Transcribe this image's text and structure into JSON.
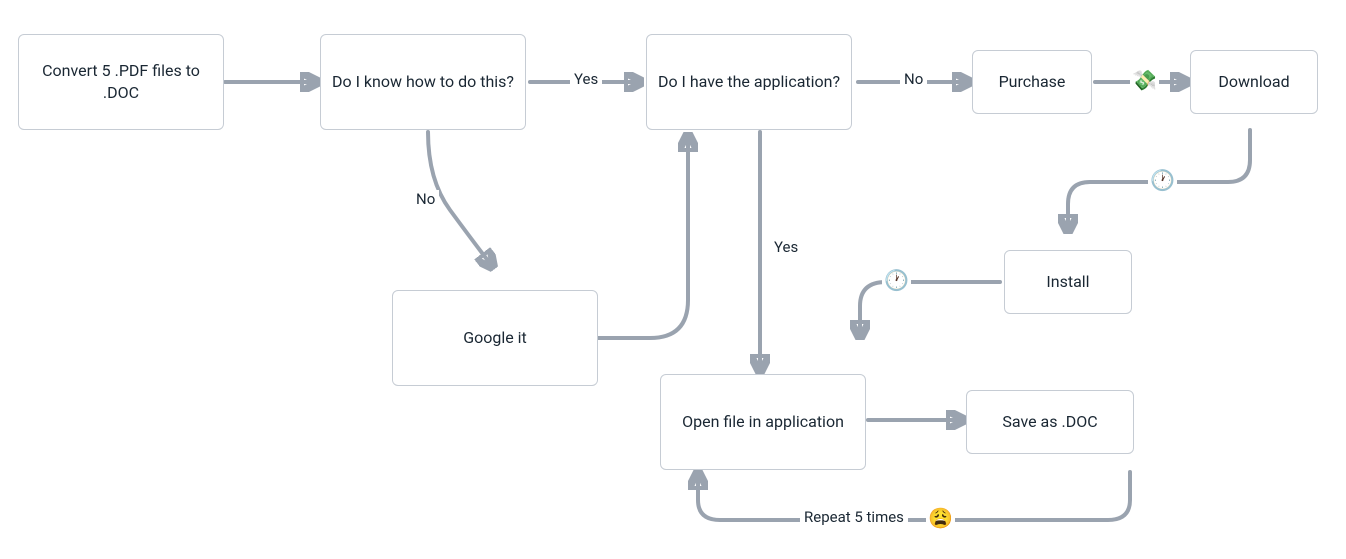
{
  "diagram": {
    "type": "flowchart",
    "nodes": {
      "convert": {
        "label": "Convert 5 .PDF files to .DOC"
      },
      "know": {
        "label": "Do I know how to do this?"
      },
      "haveapp": {
        "label": "Do I have the application?"
      },
      "purchase": {
        "label": "Purchase"
      },
      "download": {
        "label": "Download"
      },
      "google": {
        "label": "Google it"
      },
      "install": {
        "label": "Install"
      },
      "open": {
        "label": "Open file in application"
      },
      "save": {
        "label": "Save as .DOC"
      }
    },
    "edges": {
      "know_yes": {
        "label": "Yes"
      },
      "know_no": {
        "label": "No"
      },
      "haveapp_no": {
        "label": "No"
      },
      "haveapp_yes": {
        "label": "Yes"
      },
      "repeat": {
        "label": "Repeat 5 times"
      },
      "money_icon": {
        "label": "💸"
      },
      "clock1_icon": {
        "label": "🕐"
      },
      "clock2_icon": {
        "label": "🕐"
      },
      "tired_icon": {
        "label": "😩"
      }
    }
  }
}
